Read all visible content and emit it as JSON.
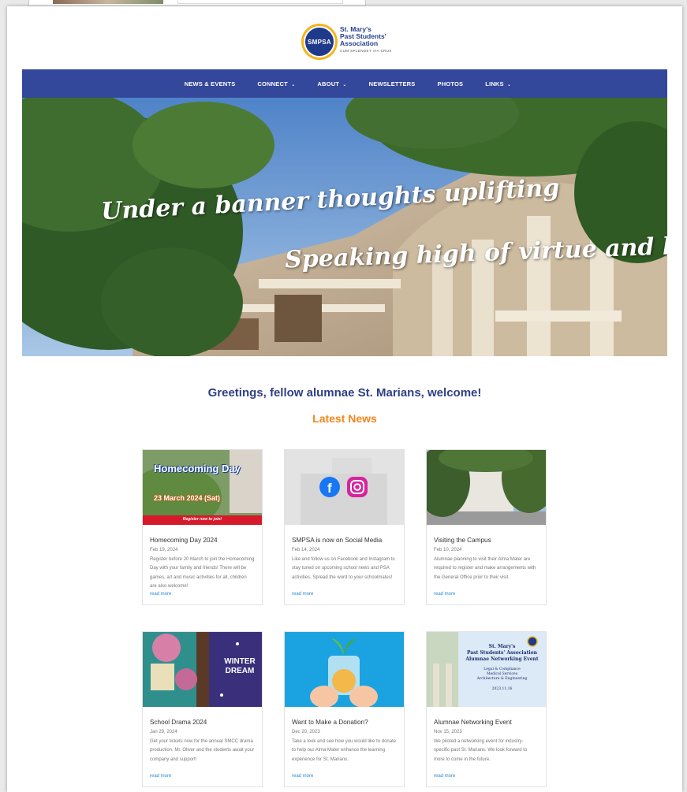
{
  "header": {
    "logo_seal": "SMPSA",
    "logo_line1": "St. Mary's",
    "logo_line2": "Past Students'",
    "logo_line3": "Association",
    "logo_line4": "CUM SPLENDET VIA CRUX"
  },
  "nav": {
    "items": [
      {
        "label": "NEWS & EVENTS",
        "chevron": false
      },
      {
        "label": "CONNECT",
        "chevron": true
      },
      {
        "label": "ABOUT",
        "chevron": true
      },
      {
        "label": "NEWSLETTERS",
        "chevron": false
      },
      {
        "label": "PHOTOS",
        "chevron": false
      },
      {
        "label": "LINKS",
        "chevron": true
      }
    ],
    "chevron_glyph": "⌄",
    "bg_color": "#33479b"
  },
  "hero": {
    "line1": "Under a banner thoughts uplifting",
    "line2": "Speaking high of virtue and love"
  },
  "greeting": "Greetings, fellow alumnae St. Marians, welcome!",
  "latest_heading": "Latest News",
  "read_more": "read more",
  "cards": [
    {
      "title": "Homecoming Day 2024",
      "date": "Feb 19, 2024",
      "desc": "Register before 20 March to join the Homecoming Day with your family and friends! There will be games, art and music activities for all, children are also welcome!",
      "img_heading": "Homecoming Day",
      "img_date": "23 March 2024 (Sat)",
      "img_banner": "Register now to join!"
    },
    {
      "title": "SMPSA is now on Social Media",
      "date": "Feb 14, 2024",
      "desc": "Like and follow us on Facebook and Instagram to stay tuned on upcoming school news and PSA activities. Spread the word to your schoolmates!",
      "img_icons": [
        "facebook-icon",
        "instagram-icon"
      ]
    },
    {
      "title": "Visiting the Campus",
      "date": "Feb 10, 2024",
      "desc": "Alumnae planning to visit their Alma Mater are required to register and make arrangements with the General Office prior to their visit."
    },
    {
      "title": "School Drama 2024",
      "date": "Jan 29, 2024",
      "desc": "Get your tickets now for the annual SMCC drama production. Mr. Oliver and the students await your company and support!",
      "img_text": "WINTER DREAM"
    },
    {
      "title": "Want to Make a Donation?",
      "date": "Dec 20, 2023",
      "desc": "Take a look and see how you would like to donate to help our Alma Mater enhance the learning experience for St. Marians."
    },
    {
      "title": "Alumnae Networking Event",
      "date": "Nov 15, 2023",
      "desc": "We piloted a networking event for industry-specific past St. Marians. We look forward to more to come in the future.",
      "img_line1": "St. Mary's",
      "img_line2": "Past Students' Association",
      "img_line3": "Alumnae Networking Event",
      "img_line4": "Legal & Compliance",
      "img_line5": "Medical Services",
      "img_line6": "Architecture & Engineering",
      "img_date": "2023.11.16"
    }
  ],
  "colors": {
    "brand_blue": "#33479b",
    "heading_blue": "#2e3f86",
    "accent_orange": "#f3851b",
    "link_blue": "#2a8ad6"
  }
}
